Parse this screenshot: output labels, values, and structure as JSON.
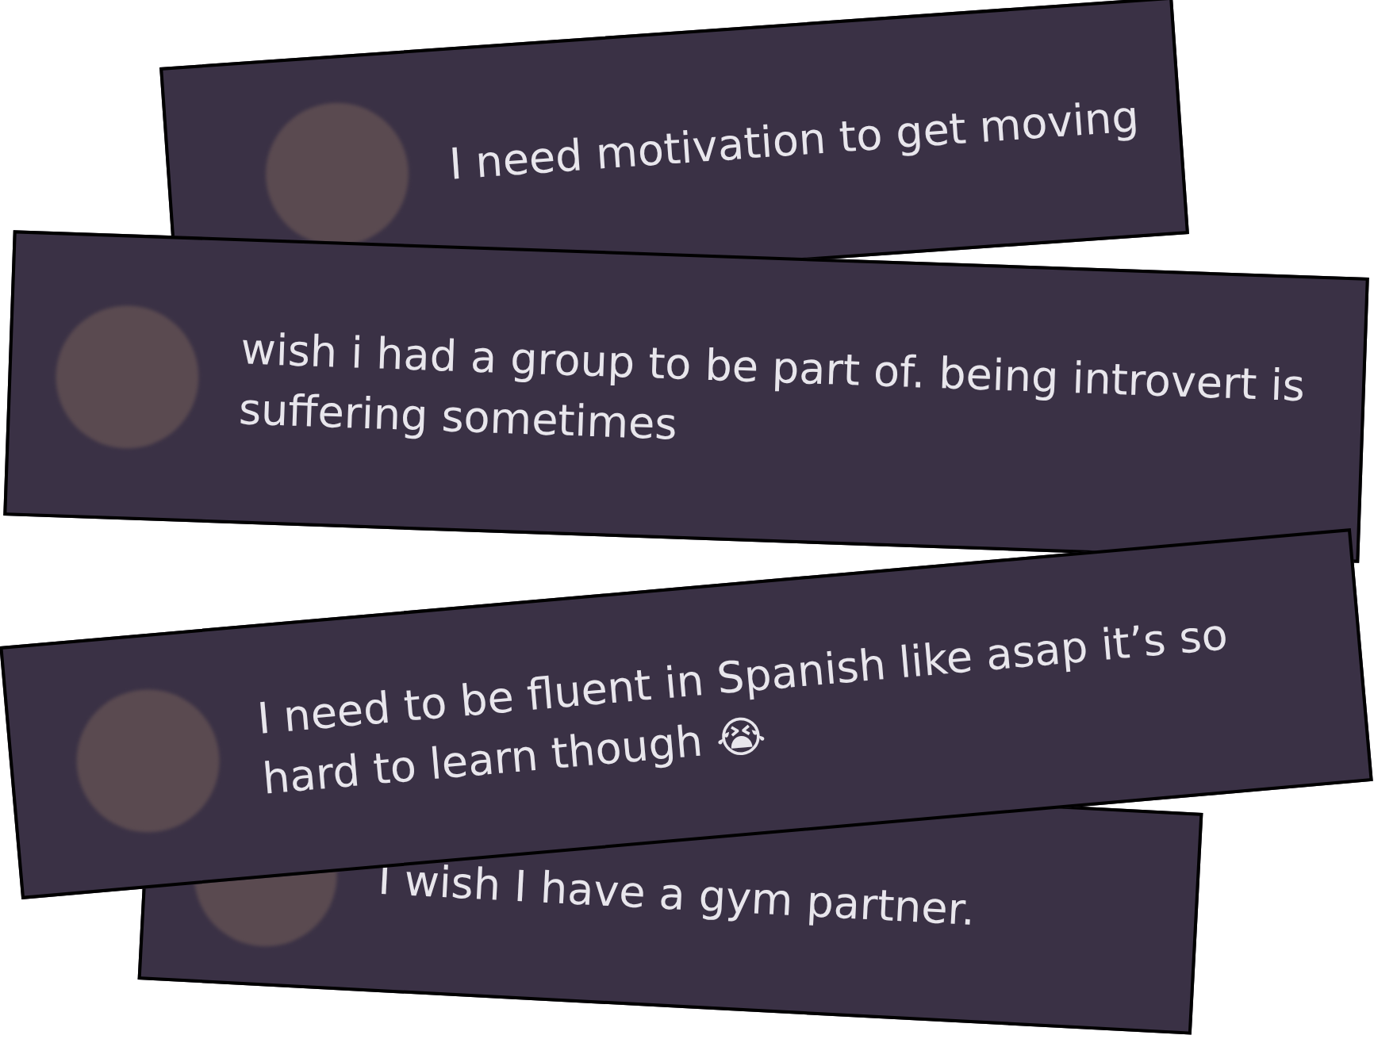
{
  "cards": [
    {
      "text": "I need motivation to get moving"
    },
    {
      "text": "wish i had a group to be part of. being introvert is suffering sometimes"
    },
    {
      "text": "I need to be fluent in Spanish like asap it’s so hard to learn though 😭"
    },
    {
      "text": "I wish I have a gym partner."
    }
  ]
}
